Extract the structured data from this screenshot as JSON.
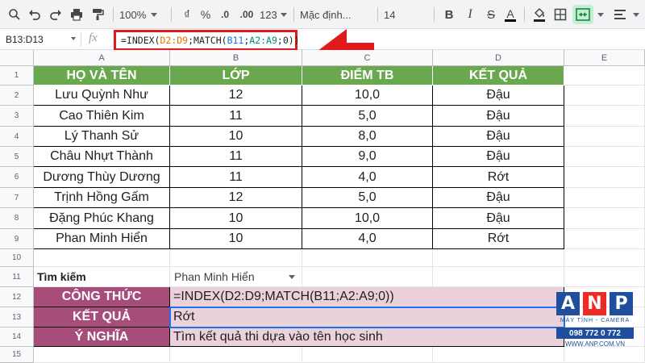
{
  "toolbar": {
    "zoom": "100%",
    "currency": "₫",
    "percent": "%",
    "decrease_decimal": ".0",
    "increase_decimal": ".00",
    "more_formats": "123",
    "font_name": "Mặc định...",
    "font_size": "14",
    "bold": "B",
    "italic": "I",
    "strikethrough": "S",
    "text_color": "A"
  },
  "formula_bar": {
    "name_box": "B13:D13",
    "fx": "fx",
    "formula_parts": [
      "=INDEX(",
      "D2:D9",
      ";MATCH(",
      "B11",
      ";",
      "A2:A9",
      ";0))"
    ]
  },
  "grid": {
    "columns": [
      "A",
      "B",
      "C",
      "D",
      "E"
    ],
    "rows": [
      "1",
      "2",
      "3",
      "4",
      "5",
      "6",
      "7",
      "8",
      "9",
      "10",
      "11",
      "12",
      "13",
      "14",
      "15"
    ],
    "table_headers": [
      "HỌ VÀ TÊN",
      "LỚP",
      "ĐIỂM TB",
      "KẾT QUẢ"
    ],
    "students": [
      [
        "Lưu Quỳnh Như",
        "12",
        "10,0",
        "Đậu"
      ],
      [
        "Cao Thiên Kim",
        "11",
        "5,0",
        "Đậu"
      ],
      [
        "Lý Thanh Sử",
        "10",
        "8,0",
        "Đậu"
      ],
      [
        "Châu Nhựt Thành",
        "11",
        "9,0",
        "Đậu"
      ],
      [
        "Dương Thùy Dương",
        "11",
        "4,0",
        "Rớt"
      ],
      [
        "Trịnh Hồng Gấm",
        "12",
        "5,0",
        "Đậu"
      ],
      [
        "Đặng Phúc Khang",
        "10",
        "10,0",
        "Đậu"
      ],
      [
        "Phan Minh Hiển",
        "10",
        "4,0",
        "Rớt"
      ]
    ],
    "search_label": "Tìm kiếm",
    "search_value": "Phan Minh Hiển",
    "results": [
      {
        "label": "CÔNG THỨC",
        "value": "=INDEX(D2:D9;MATCH(B11;A2:A9;0))"
      },
      {
        "label": "KẾT QUẢ",
        "value": "Rớt"
      },
      {
        "label": "Ý NGHĨA",
        "value": "Tìm kết quả thi dựa vào tên học sinh"
      }
    ]
  },
  "logo": {
    "letters": [
      "A",
      "N",
      "P"
    ],
    "tagline": "MÁY TÍNH - CAMERA",
    "phone": "098 772 0 772",
    "website": "WWW.ANP.COM.VN"
  },
  "colors": {
    "header_green": "#6aa84f",
    "label_maroon": "#a64d79",
    "value_pink": "#ead1dc",
    "arrow_red": "#e11b1b",
    "selection_blue": "#1a73e8"
  }
}
